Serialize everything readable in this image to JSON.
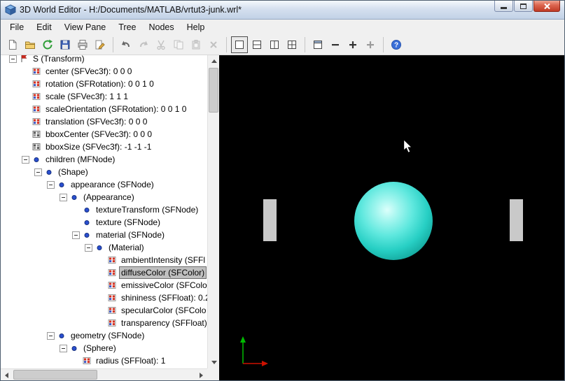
{
  "window": {
    "title": "3D World Editor - H:/Documents/MATLAB/vrtut3-junk.wrl*",
    "controls": [
      "minimize",
      "maximize",
      "close"
    ]
  },
  "menu": {
    "items": [
      "File",
      "Edit",
      "View Pane",
      "Tree",
      "Nodes",
      "Help"
    ]
  },
  "toolbar": {
    "buttons": [
      {
        "name": "new",
        "group": 1
      },
      {
        "name": "open",
        "group": 1
      },
      {
        "name": "refresh",
        "group": 1
      },
      {
        "name": "save",
        "group": 1
      },
      {
        "name": "print",
        "group": 1
      },
      {
        "name": "edit",
        "group": 1
      },
      {
        "name": "undo",
        "group": 2
      },
      {
        "name": "redo",
        "group": 2,
        "disabled": true
      },
      {
        "name": "cut",
        "group": 2,
        "disabled": true
      },
      {
        "name": "copy",
        "group": 2,
        "disabled": true
      },
      {
        "name": "paste",
        "group": 2,
        "disabled": true
      },
      {
        "name": "delete",
        "group": 2,
        "disabled": true
      },
      {
        "name": "pane-single",
        "group": 3,
        "selected": true
      },
      {
        "name": "pane-split-horizontal",
        "group": 3
      },
      {
        "name": "pane-split-vertical",
        "group": 3
      },
      {
        "name": "pane-grid",
        "group": 3
      },
      {
        "name": "view-fit",
        "group": 4
      },
      {
        "name": "zoom-out",
        "group": 4
      },
      {
        "name": "zoom-in",
        "group": 4
      },
      {
        "name": "zoom-in-alt",
        "group": 4,
        "disabled": true
      },
      {
        "name": "help",
        "group": 5
      }
    ]
  },
  "tree": {
    "items": [
      {
        "text": "S (Transform)",
        "level": 1,
        "icon": "transform-flag",
        "exp": true
      },
      {
        "text": "center (SFVec3f): 0  0  0",
        "level": 2,
        "icon": "field"
      },
      {
        "text": "rotation (SFRotation): 0  0  1  0",
        "level": 2,
        "icon": "field"
      },
      {
        "text": "scale (SFVec3f): 1  1  1",
        "level": 2,
        "icon": "field"
      },
      {
        "text": "scaleOrientation (SFRotation): 0  0  1  0",
        "level": 2,
        "icon": "field"
      },
      {
        "text": "translation (SFVec3f): 0  0  0",
        "level": 2,
        "icon": "field"
      },
      {
        "text": "bboxCenter (SFVec3f): 0  0  0",
        "level": 2,
        "icon": "field-plain"
      },
      {
        "text": "bboxSize (SFVec3f): -1  -1  -1",
        "level": 2,
        "icon": "field-plain"
      },
      {
        "text": "children (MFNode)",
        "level": 2,
        "icon": "node",
        "exp": true
      },
      {
        "text": "(Shape)",
        "level": 3,
        "icon": "node",
        "exp": true
      },
      {
        "text": "appearance (SFNode)",
        "level": 4,
        "icon": "node",
        "exp": true
      },
      {
        "text": "(Appearance)",
        "level": 5,
        "icon": "node",
        "exp": true
      },
      {
        "text": "textureTransform (SFNode)",
        "level": 6,
        "icon": "node"
      },
      {
        "text": "texture (SFNode)",
        "level": 6,
        "icon": "node"
      },
      {
        "text": "material (SFNode)",
        "level": 6,
        "icon": "node",
        "exp": true
      },
      {
        "text": "(Material)",
        "level": 7,
        "icon": "node",
        "exp": true
      },
      {
        "text": "ambientIntensity (SFFl",
        "level": 8,
        "icon": "field"
      },
      {
        "text": "diffuseColor (SFColor)",
        "level": 8,
        "icon": "field",
        "sel": true
      },
      {
        "text": "emissiveColor (SFColo",
        "level": 8,
        "icon": "field"
      },
      {
        "text": "shininess (SFFloat): 0.2",
        "level": 8,
        "icon": "field"
      },
      {
        "text": "specularColor (SFColo",
        "level": 8,
        "icon": "field"
      },
      {
        "text": "transparency (SFFloat)",
        "level": 8,
        "icon": "field"
      },
      {
        "text": "geometry (SFNode)",
        "level": 4,
        "icon": "node",
        "exp": true
      },
      {
        "text": "(Sphere)",
        "level": 5,
        "icon": "node",
        "exp": true
      },
      {
        "text": "radius (SFFloat): 1",
        "level": 6,
        "icon": "field"
      }
    ]
  },
  "viewport": {
    "background": "#000000",
    "objects": [
      {
        "name": "sphere",
        "color": "#2fd6cb"
      },
      {
        "name": "left-box",
        "color": "#c9c9c9"
      },
      {
        "name": "right-box",
        "color": "#c9c9c9"
      },
      {
        "name": "axis-indicator",
        "x_color": "#cc1100",
        "y_color": "#00bb00"
      },
      {
        "name": "mouse-cursor",
        "color": "#ffffff"
      }
    ]
  }
}
